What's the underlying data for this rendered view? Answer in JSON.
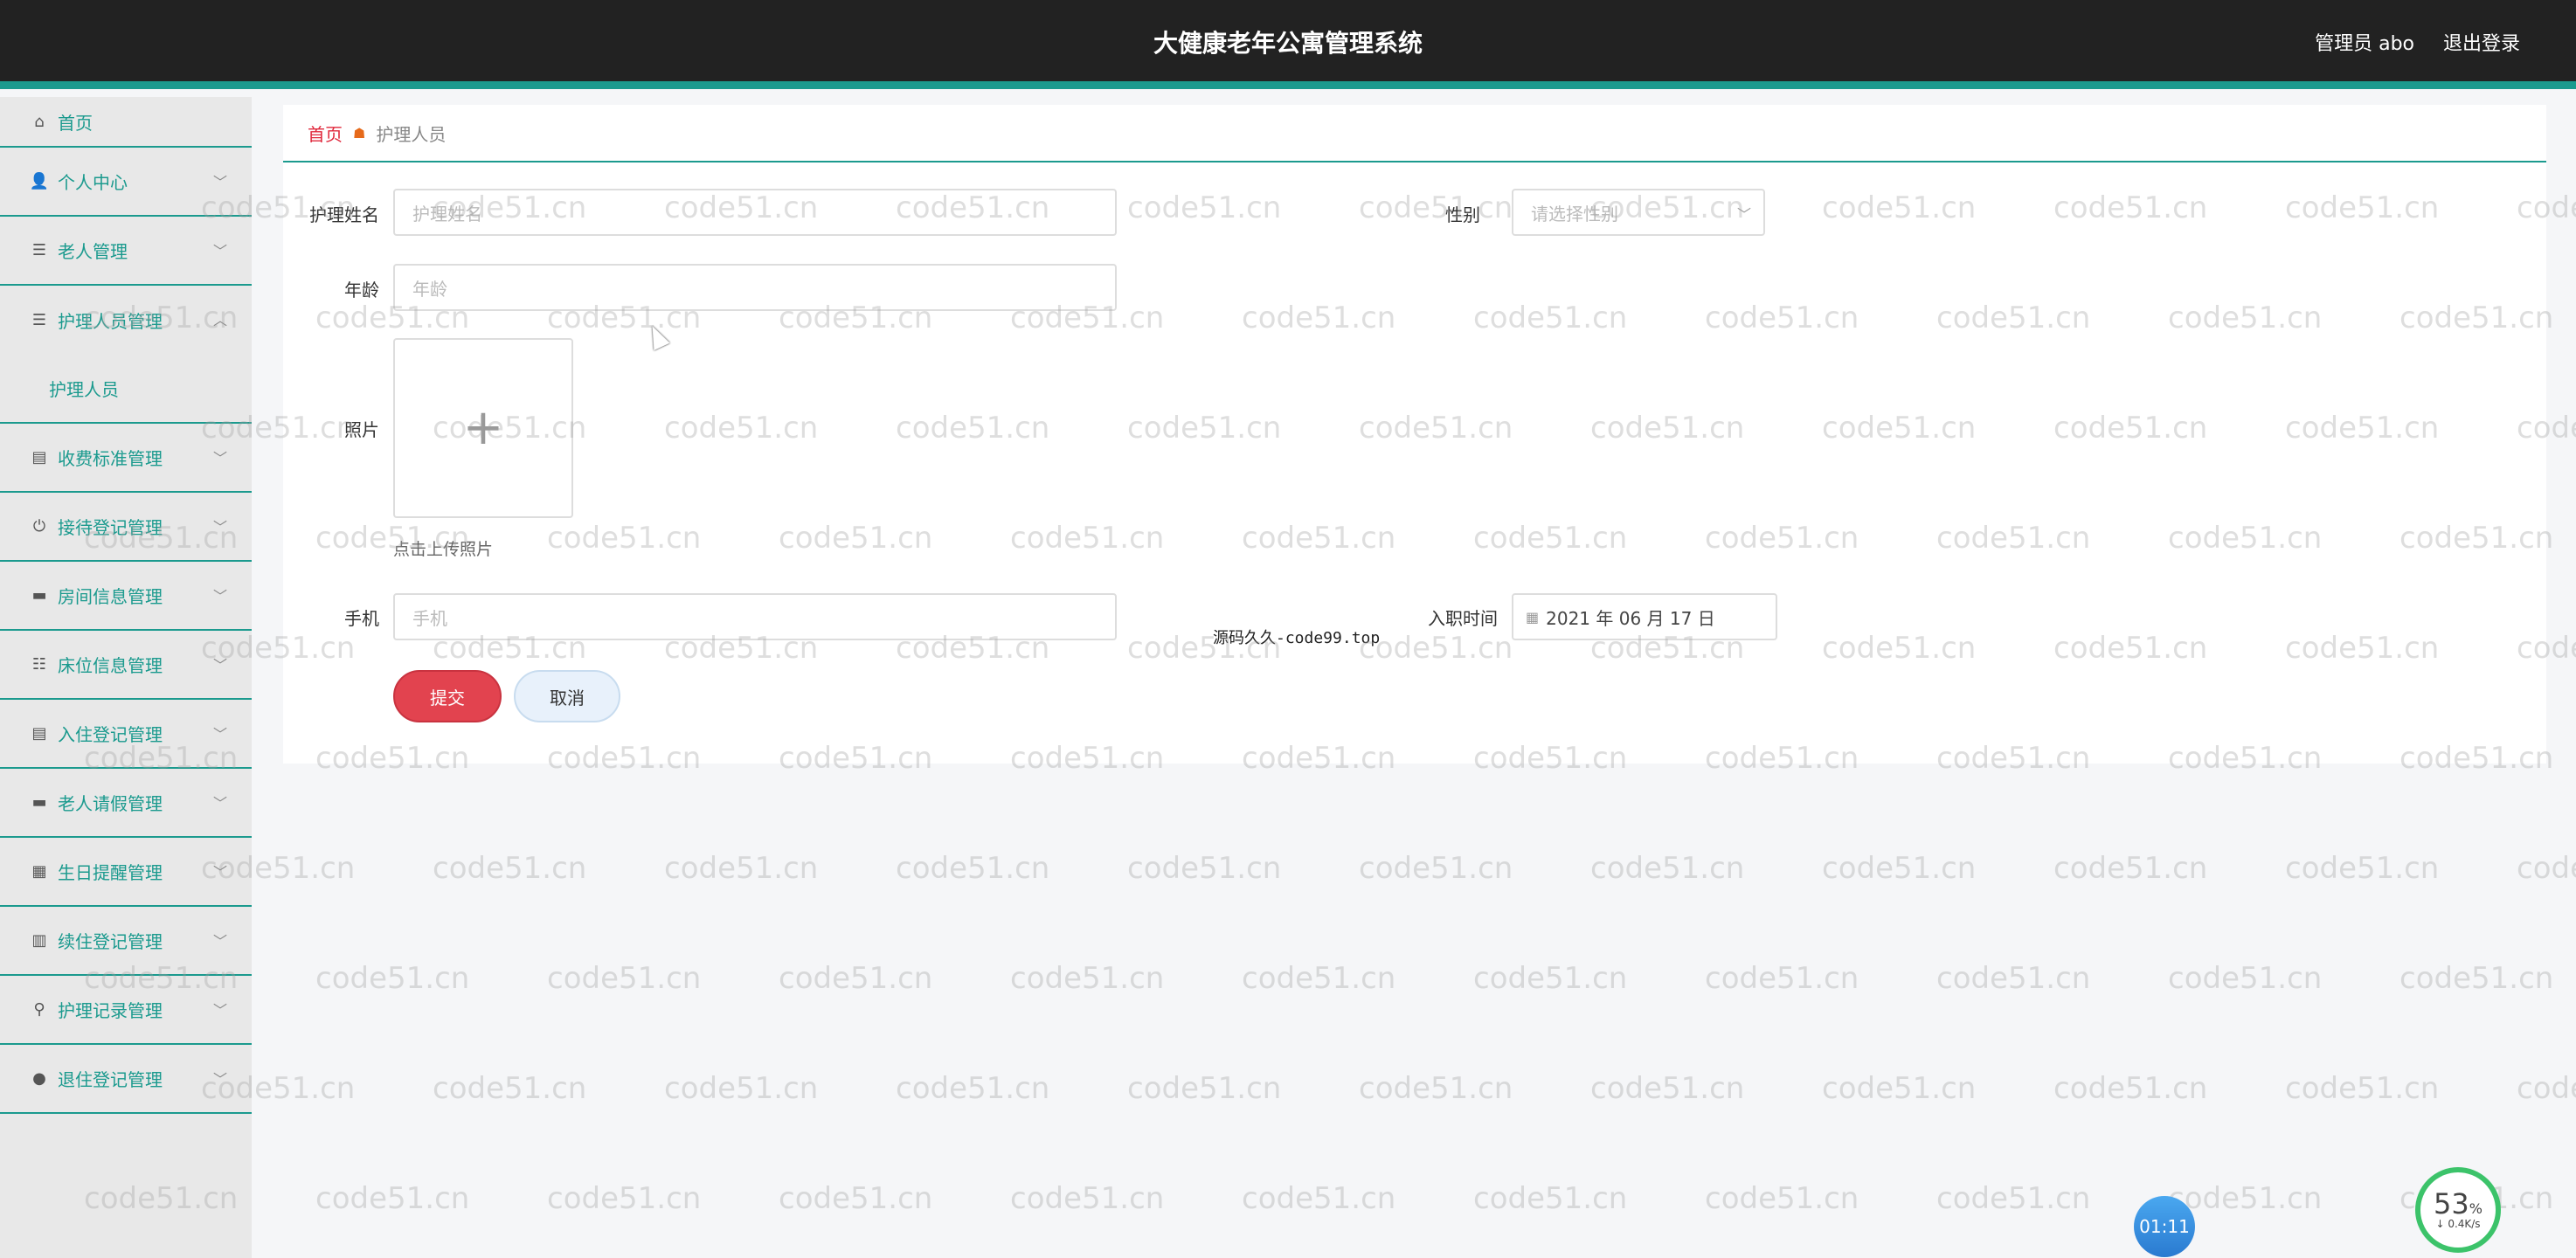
{
  "header": {
    "title": "大健康老年公寓管理系统",
    "user_label": "管理员 abo",
    "logout_label": "退出登录"
  },
  "sidebar": {
    "items": [
      {
        "label": "首页",
        "icon": "home-icon"
      },
      {
        "label": "个人中心",
        "icon": "user-icon"
      },
      {
        "label": "老人管理",
        "icon": "list-icon"
      },
      {
        "label": "护理人员管理",
        "icon": "list-icon",
        "expanded": true
      },
      {
        "label": "收费标准管理",
        "icon": "clipboard-icon"
      },
      {
        "label": "接待登记管理",
        "icon": "power-icon"
      },
      {
        "label": "房间信息管理",
        "icon": "monitor-icon"
      },
      {
        "label": "床位信息管理",
        "icon": "sliders-icon"
      },
      {
        "label": "入住登记管理",
        "icon": "clipboard-icon"
      },
      {
        "label": "老人请假管理",
        "icon": "laptop-icon"
      },
      {
        "label": "生日提醒管理",
        "icon": "grid-icon"
      },
      {
        "label": "续住登记管理",
        "icon": "bar-chart-icon"
      },
      {
        "label": "护理记录管理",
        "icon": "person-icon"
      },
      {
        "label": "退住登记管理",
        "icon": "mic-icon"
      }
    ],
    "submenu": {
      "label": "护理人员"
    }
  },
  "breadcrumb": {
    "home": "首页",
    "current": "护理人员"
  },
  "form": {
    "name_label": "护理姓名",
    "name_placeholder": "护理姓名",
    "gender_label": "性别",
    "gender_placeholder": "请选择性别",
    "age_label": "年龄",
    "age_placeholder": "年龄",
    "photo_label": "照片",
    "photo_tip": "点击上传照片",
    "phone_label": "手机",
    "phone_placeholder": "手机",
    "hire_label": "入职时间",
    "hire_value": "2021 年 06 月 17 日",
    "submit_label": "提交",
    "cancel_label": "取消"
  },
  "overlay": {
    "source_note": "源码久久-code99.top",
    "watermark": "code51.cn",
    "timer": "01:11",
    "gauge_percent": "53",
    "gauge_unit": "%",
    "gauge_speed": "0.4K/s"
  },
  "colors": {
    "accent": "#1b9a8e",
    "topbar": "#222222",
    "submit": "#e2434f",
    "crumb_home": "#e0283c"
  }
}
